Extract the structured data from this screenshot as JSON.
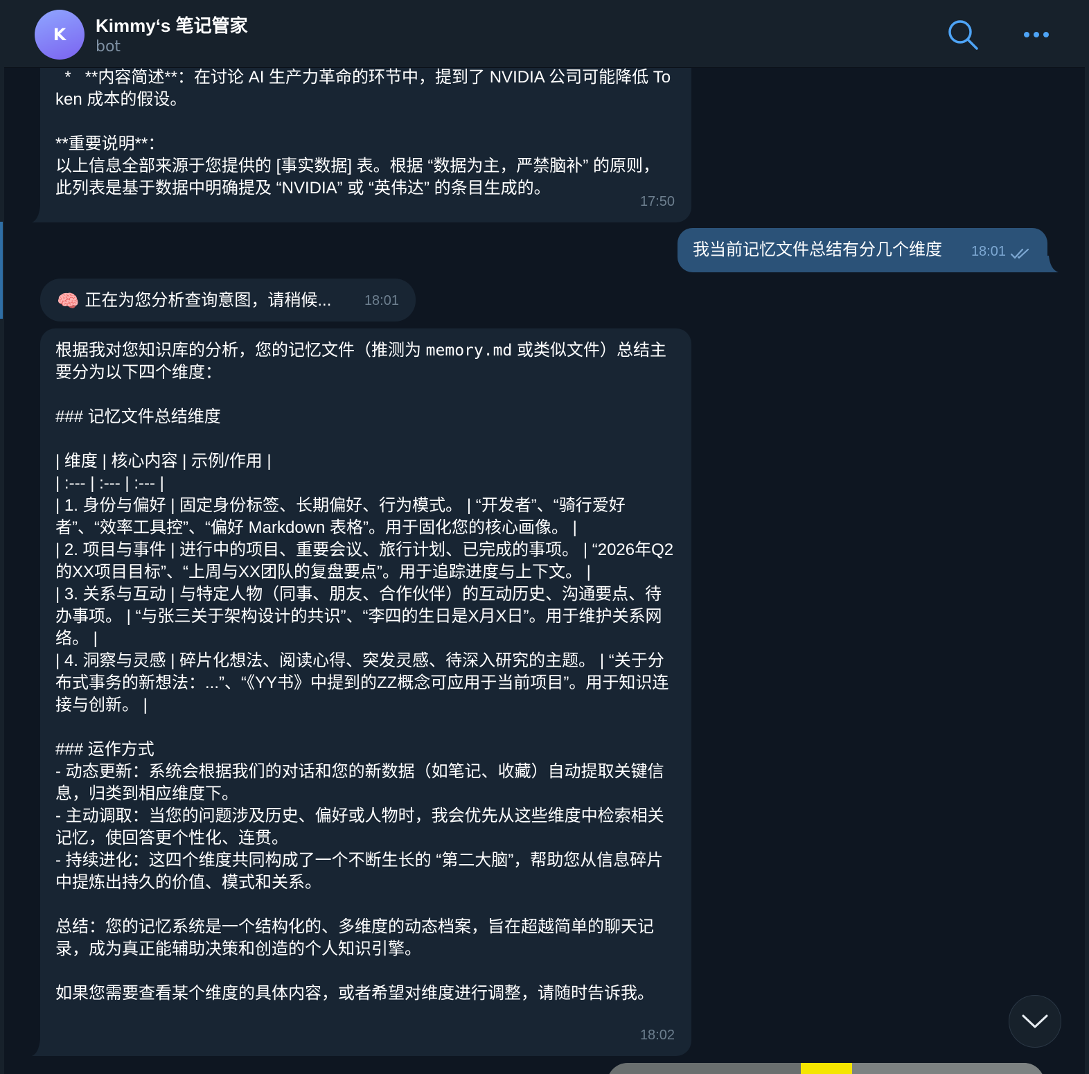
{
  "header": {
    "avatar_letter": "K",
    "title": "Kimmy‘s 笔记管家",
    "subtitle": "bot"
  },
  "colors": {
    "background": "#0e1621",
    "incoming_bubble": "#182533",
    "outgoing_bubble": "#2b5278",
    "accent": "#4ea4f6"
  },
  "icons": {
    "search": "search-icon",
    "more": "more-dots-icon",
    "read_receipt": "double-check-icon",
    "scroll_down": "chevron-down-icon"
  },
  "messages": [
    {
      "direction": "in",
      "text": "  *   **内容简述**：在讨论 AI 生产力革命的环节中，提到了 NVIDIA 公司可能降低 Token 成本的假设。\n\n**重要说明**：\n以上信息全部来源于您提供的 [事实数据] 表。根据 “数据为主，严禁脑补” 的原则，此列表是基于数据中明确提及 “NVIDIA” 或 “英伟达” 的条目生成的。",
      "time": "17:50"
    },
    {
      "direction": "out",
      "text": "我当前记忆文件总结有分几个维度",
      "time": "18:01"
    },
    {
      "direction": "in",
      "emoji": "🧠",
      "text": "正在为您分析查询意图，请稍候...",
      "time": "18:01"
    },
    {
      "direction": "in",
      "intro_before": "根据我对您知识库的分析，您的记忆文件（推测为 ",
      "intro_code": "memory.md",
      "intro_after": " 或类似文件）总结主要分为以下四个维度：",
      "body": "\n### 记忆文件总结维度\n\n| 维度 | 核心内容 | 示例/作用 |\n| :--- | :--- | :--- |\n| 1. 身份与偏好 | 固定身份标签、长期偏好、行为模式。 | “开发者”、“骑行爱好者”、“效率工具控”、“偏好 Markdown 表格”。用于固化您的核心画像。 |\n| 2. 项目与事件 | 进行中的项目、重要会议、旅行计划、已完成的事项。 | “2026年Q2的XX项目目标”、“上周与XX团队的复盘要点”。用于追踪进度与上下文。 |\n| 3. 关系与互动 | 与特定人物（同事、朋友、合作伙伴）的互动历史、沟通要点、待办事项。 | “与张三关于架构设计的共识”、“李四的生日是X月X日”。用于维护关系网络。 |\n| 4. 洞察与灵感 | 碎片化想法、阅读心得、突发灵感、待深入研究的主题。 | “关于分布式事务的新想法：...”、“《YY书》中提到的ZZ概念可应用于当前项目”。用于知识连接与创新。 |\n\n### 运作方式\n- 动态更新：系统会根据我们的对话和您的新数据（如笔记、收藏）自动提取关键信息，归类到相应维度下。\n- 主动调取：当您的问题涉及历史、偏好或人物时，我会优先从这些维度中检索相关记忆，使回答更个性化、连贯。\n- 持续进化：这四个维度共同构成了一个不断生长的 “第二大脑”，帮助您从信息碎片中提炼出持久的价值、模式和关系。\n\n总结：您的记忆系统是一个结构化的、多维度的动态档案，旨在超越简单的聊天记录，成为真正能辅助决策和创造的个人知识引擎。\n\n如果您需要查看某个维度的具体内容，或者希望对维度进行调整，请随时告诉我。",
      "time": "18:02"
    }
  ]
}
